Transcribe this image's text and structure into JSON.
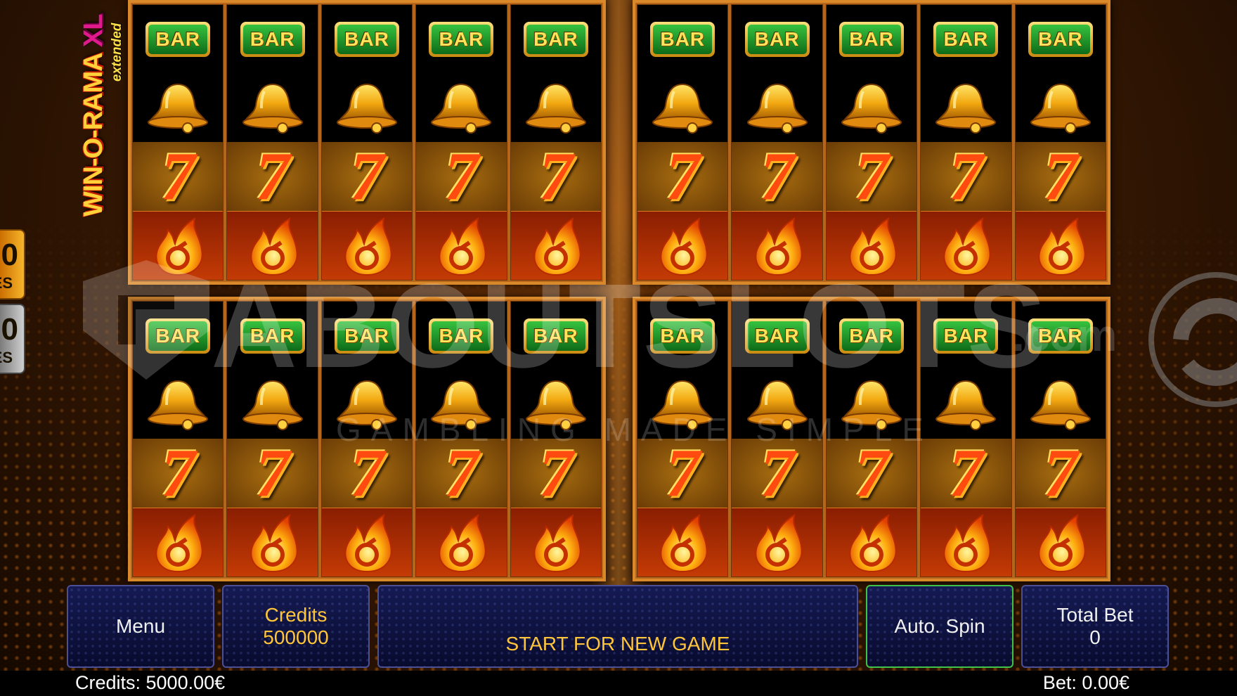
{
  "game": {
    "logo_main": "WIN-O-RAMA",
    "logo_xl": "XL",
    "logo_sub": "extended"
  },
  "side_tabs": [
    {
      "big": "0",
      "small": "ES",
      "color": "#f7b52a"
    },
    {
      "big": "0",
      "small": "ES",
      "color": "#cfcfcf"
    }
  ],
  "reel_sets": [
    {
      "name": "top-left",
      "columns": 5,
      "rows": [
        "bar",
        "bell",
        "seven",
        "fire"
      ]
    },
    {
      "name": "top-right",
      "columns": 5,
      "rows": [
        "bar",
        "bell",
        "seven",
        "fire"
      ]
    },
    {
      "name": "bottom-left",
      "columns": 5,
      "rows": [
        "bar",
        "bell",
        "seven",
        "fire"
      ]
    },
    {
      "name": "bottom-right",
      "columns": 5,
      "rows": [
        "bar",
        "bell",
        "seven",
        "fire"
      ]
    }
  ],
  "symbols": {
    "bar_label": "BAR",
    "seven_label": "7"
  },
  "watermark": {
    "title": "ABOUTSLOTS",
    "suffix": ".com",
    "tagline": "GAMBLING MADE SIMPLE"
  },
  "controls": {
    "menu": "Menu",
    "credits_label": "Credits",
    "credits_value": "500000",
    "message": "START FOR NEW GAME",
    "auto_spin": "Auto. Spin",
    "total_bet_label": "Total Bet",
    "total_bet_value": "0"
  },
  "status": {
    "credits": "Credits: 5000.00€",
    "bet": "Bet: 0.00€"
  },
  "colors": {
    "accent_gold": "#ffc53a",
    "panel_blue": "#151a52",
    "auto_spin_border": "#3fc24a"
  }
}
